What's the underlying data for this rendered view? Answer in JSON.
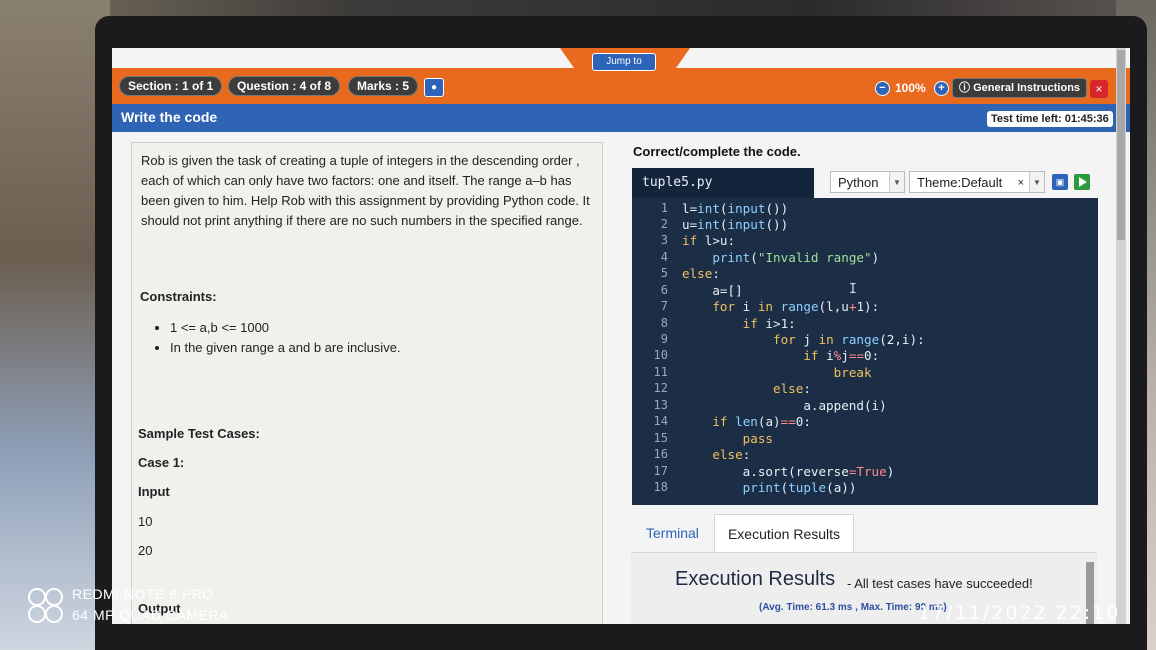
{
  "header": {
    "jump_to": "Jump to",
    "section": "Section : 1 of 1",
    "question": "Question : 4 of 8",
    "marks": "Marks : 5",
    "zoom": "100%",
    "general_instructions": "General Instructions",
    "close": "×"
  },
  "titlebar": {
    "title": "Write the code",
    "timer": "Test time left: 01:45:36"
  },
  "problem": {
    "text": "Rob is given the task of creating a tuple of integers in the descending order , each of which can only have two factors: one and itself. The range a–b has been given to him. Help Rob with this assignment by providing Python code. It should not print anything if there are no such numbers in the specified range.",
    "constraints_label": "Constraints:",
    "constraints": [
      "1 <= a,b <= 1000",
      "In the given range a and b are inclusive."
    ],
    "sample_label": "Sample Test Cases:",
    "case_label": "Case 1:",
    "input_label": "Input",
    "inputs": [
      "10",
      "20"
    ],
    "output_label": "Output"
  },
  "editor": {
    "heading": "Correct/complete the code.",
    "filename": "tuple5.py",
    "language": "Python",
    "theme": "Theme:Default",
    "line_numbers": [
      "1",
      "2",
      "3",
      "4",
      "5",
      "6",
      "7",
      "8",
      "9",
      "10",
      "11",
      "12",
      "13",
      "14",
      "15",
      "16",
      "17",
      "18"
    ]
  },
  "results": {
    "tab_terminal": "Terminal",
    "tab_execution": "Execution Results",
    "title": "Execution Results",
    "subtitle": " - All test cases have succeeded!",
    "avg": "(Avg. Time: 61.3 ms , Max. Time: 90 ms)"
  },
  "watermark": {
    "device": "REDMI NOTE 8 PRO",
    "camera": "64 MP QUAD CAMERA",
    "datetime": "17/11/2022 22:10"
  },
  "colors": {
    "orange": "#e86a1f",
    "blue": "#2f64b5",
    "editor_bg": "#1b2e46"
  }
}
